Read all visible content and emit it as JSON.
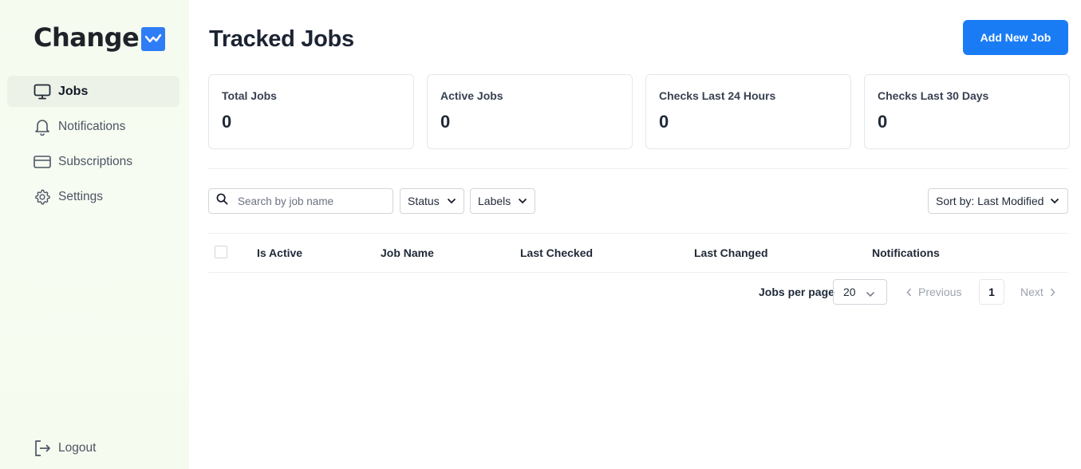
{
  "brand": {
    "name": "Change",
    "accent": "#1a7cf4"
  },
  "sidebar": {
    "items": [
      {
        "label": "Jobs",
        "icon": "monitor-icon",
        "active": true
      },
      {
        "label": "Notifications",
        "icon": "bell-icon",
        "active": false
      },
      {
        "label": "Subscriptions",
        "icon": "credit-card-icon",
        "active": false
      },
      {
        "label": "Settings",
        "icon": "gear-icon",
        "active": false
      }
    ],
    "logout": {
      "label": "Logout",
      "icon": "logout-icon"
    }
  },
  "header": {
    "title": "Tracked Jobs",
    "add_button": "Add New Job"
  },
  "stats": [
    {
      "label": "Total Jobs",
      "value": "0"
    },
    {
      "label": "Active Jobs",
      "value": "0"
    },
    {
      "label": "Checks Last 24 Hours",
      "value": "0"
    },
    {
      "label": "Checks Last 30 Days",
      "value": "0"
    }
  ],
  "filters": {
    "search_placeholder": "Search by job name",
    "status_label": "Status",
    "labels_label": "Labels",
    "sort_label": "Sort by: Last Modified"
  },
  "table": {
    "columns": [
      "Is Active",
      "Job Name",
      "Last Checked",
      "Last Changed",
      "Notifications"
    ],
    "rows": []
  },
  "pagination": {
    "per_page_label": "Jobs per page",
    "per_page_value": "20",
    "previous": "Previous",
    "current_page": "1",
    "next": "Next"
  }
}
